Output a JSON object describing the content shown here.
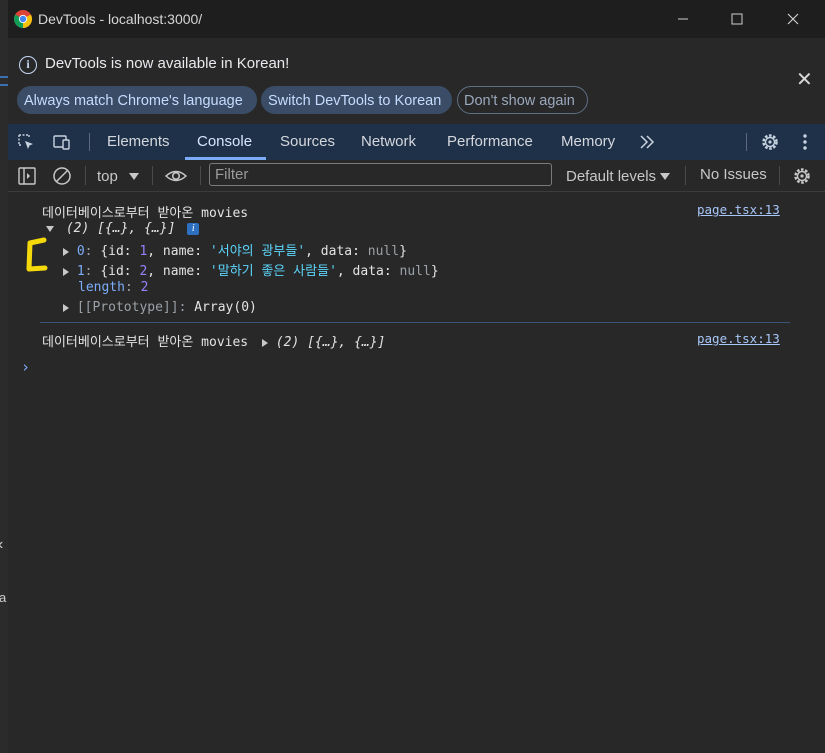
{
  "window": {
    "title": "DevTools - localhost:3000/"
  },
  "infobar": {
    "message": "DevTools is now available in Korean!",
    "buttons": [
      "Always match Chrome's language",
      "Switch DevTools to Korean",
      "Don't show again"
    ]
  },
  "tabs": {
    "items": [
      "Elements",
      "Console",
      "Sources",
      "Network",
      "Performance",
      "Memory"
    ],
    "active": "Console"
  },
  "toolbar": {
    "context": "top",
    "filter_placeholder": "Filter",
    "levels": "Default levels",
    "issues": "No Issues"
  },
  "console": {
    "entry1": {
      "message": "데이터베이스로부터 받아온 movies",
      "source": "page.tsx:13",
      "summary": "(2) [{…}, {…}]",
      "item0": {
        "index": "0",
        "id": "1",
        "name": "'서야의 광부들'",
        "data": "null"
      },
      "item1": {
        "index": "1",
        "id": "2",
        "name": "'말하기 좋은 사람들'",
        "data": "null"
      },
      "length_key": "length",
      "length_val": "2",
      "prototype": "[[Prototype]]",
      "prototype_val": "Array(0)"
    },
    "entry2": {
      "message": "데이터베이스로부터 받아온 movies",
      "summary": "(2) [{…}, {…}]",
      "source": "page.tsx:13"
    },
    "prompt": "›"
  },
  "left_strip": {
    "letter": "a"
  },
  "colors": {
    "tabbar_bg": "#1f3049",
    "accent": "#7cacf8",
    "string": "#5cd5fb",
    "annotation": "#f5d90a"
  }
}
